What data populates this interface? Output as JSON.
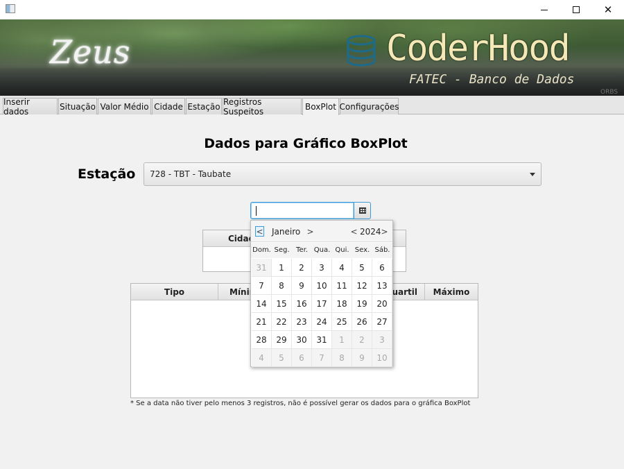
{
  "window": {
    "controls": {
      "minimize": "minimize",
      "maximize": "maximize",
      "close": "✕"
    }
  },
  "banner": {
    "app_name": "Zeus",
    "brand": "CoderHood",
    "subtitle": "FATEC - Banco de Dados",
    "watermark": "ORBS",
    "icon": "database-icon"
  },
  "tabs": [
    {
      "label": "Inserir dados"
    },
    {
      "label": "Situação"
    },
    {
      "label": "Valor Médio"
    },
    {
      "label": "Cidade"
    },
    {
      "label": "Estação"
    },
    {
      "label": "Registros Suspeitos"
    },
    {
      "label": "BoxPlot",
      "active": true
    },
    {
      "label": "Configurações"
    }
  ],
  "main": {
    "heading": "Dados para Gráfico BoxPlot",
    "station_label": "Estação",
    "station_selected": "728 - TBT - Taubate",
    "date_value": "",
    "small_table": {
      "column": "Cidad"
    },
    "big_table": {
      "columns": [
        "Tipo",
        "Mínin",
        "Quartil",
        "Máximo"
      ]
    },
    "note": "* Se a data não tiver pelo menos 3 registros, não é possível gerar os dados para o gráfica BoxPlot"
  },
  "calendar": {
    "month": "Janeiro",
    "year": "2024",
    "prev_month": "<",
    "next_month": ">",
    "prev_year": "<",
    "next_year": ">",
    "weekdays": [
      "Dom.",
      "Seg.",
      "Ter.",
      "Qua.",
      "Qui.",
      "Sex.",
      "Sáb."
    ],
    "weeks": [
      [
        "31",
        "1",
        "2",
        "3",
        "4",
        "5",
        "6"
      ],
      [
        "7",
        "8",
        "9",
        "10",
        "11",
        "12",
        "13"
      ],
      [
        "14",
        "15",
        "16",
        "17",
        "18",
        "19",
        "20"
      ],
      [
        "21",
        "22",
        "23",
        "24",
        "25",
        "26",
        "27"
      ],
      [
        "28",
        "29",
        "30",
        "31",
        "1",
        "2",
        "3"
      ],
      [
        "4",
        "5",
        "6",
        "7",
        "8",
        "9",
        "10"
      ]
    ],
    "other_month_cells": [
      [
        0,
        0
      ],
      [
        4,
        4
      ],
      [
        4,
        5
      ],
      [
        4,
        6
      ],
      [
        5,
        0
      ],
      [
        5,
        1
      ],
      [
        5,
        2
      ],
      [
        5,
        3
      ],
      [
        5,
        4
      ],
      [
        5,
        5
      ],
      [
        5,
        6
      ]
    ]
  }
}
